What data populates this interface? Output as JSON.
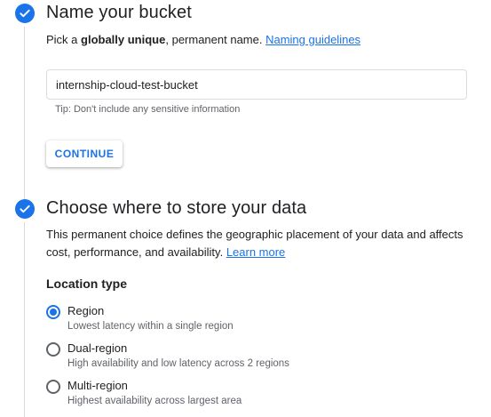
{
  "step1": {
    "heading": "Name your bucket",
    "desc_prefix": "Pick a ",
    "desc_bold": "globally unique",
    "desc_suffix": ", permanent name. ",
    "link": "Naming guidelines",
    "input_value": "internship-cloud-test-bucket",
    "tip": "Tip: Don't include any sensitive information",
    "continue_label": "CONTINUE"
  },
  "step2": {
    "heading": "Choose where to store your data",
    "desc_line1": "This permanent choice defines the geographic placement of your data and affects",
    "desc_line2": "cost, performance, and availability. ",
    "link": "Learn more",
    "location_type_label": "Location type",
    "options": [
      {
        "label": "Region",
        "desc": "Lowest latency within a single region",
        "selected": true
      },
      {
        "label": "Dual-region",
        "desc": "High availability and low latency across 2 regions",
        "selected": false
      },
      {
        "label": "Multi-region",
        "desc": "Highest availability across largest area",
        "selected": false
      }
    ]
  },
  "colors": {
    "accent": "#1a73e8",
    "text": "#202124",
    "secondary_text": "#5f6368",
    "border": "#dadce0"
  },
  "icons": {
    "step_complete": "check-circle-icon"
  }
}
